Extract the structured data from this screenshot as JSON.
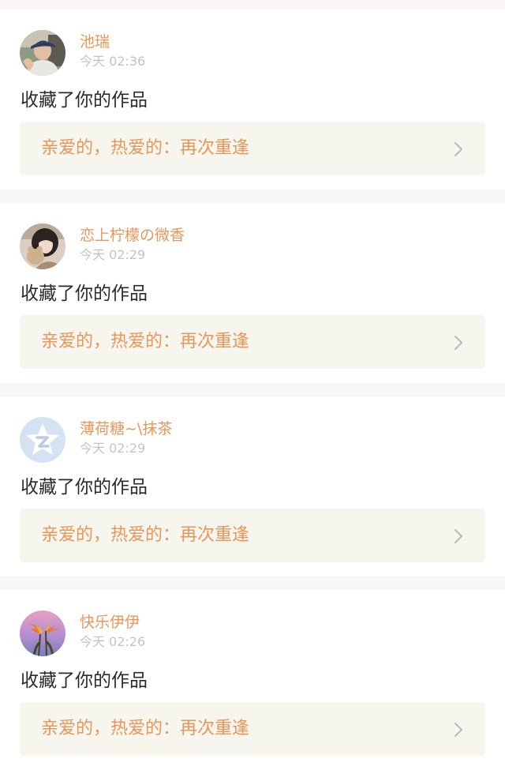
{
  "notifications": [
    {
      "username": "池瑞",
      "time": "今天 02:36",
      "action": "收藏了你的作品",
      "work_title": "亲爱的，热爱的：再次重逢",
      "avatar_icon": "avatar-photo-man-with-cap"
    },
    {
      "username": "恋上柠檬の微香",
      "time": "今天 02:29",
      "action": "收藏了你的作品",
      "work_title": "亲爱的，热爱的：再次重逢",
      "avatar_icon": "avatar-photo-girl-with-plush"
    },
    {
      "username": "薄荷糖~\\抹茶",
      "time": "今天 02:29",
      "action": "收藏了你的作品",
      "work_title": "亲爱的，热爱的：再次重逢",
      "avatar_icon": "avatar-default-qq-star"
    },
    {
      "username": "快乐伊伊",
      "time": "今天 02:26",
      "action": "收藏了你的作品",
      "work_title": "亲爱的，热爱的：再次重逢",
      "avatar_icon": "avatar-photo-bird-of-paradise-flower"
    }
  ],
  "colors": {
    "accent": "#e8965a",
    "timestamp": "#c4c4c4",
    "body_text": "#2a2a2a",
    "link_bg": "#f6f6ef",
    "page_bg": "#f7f5f5"
  }
}
